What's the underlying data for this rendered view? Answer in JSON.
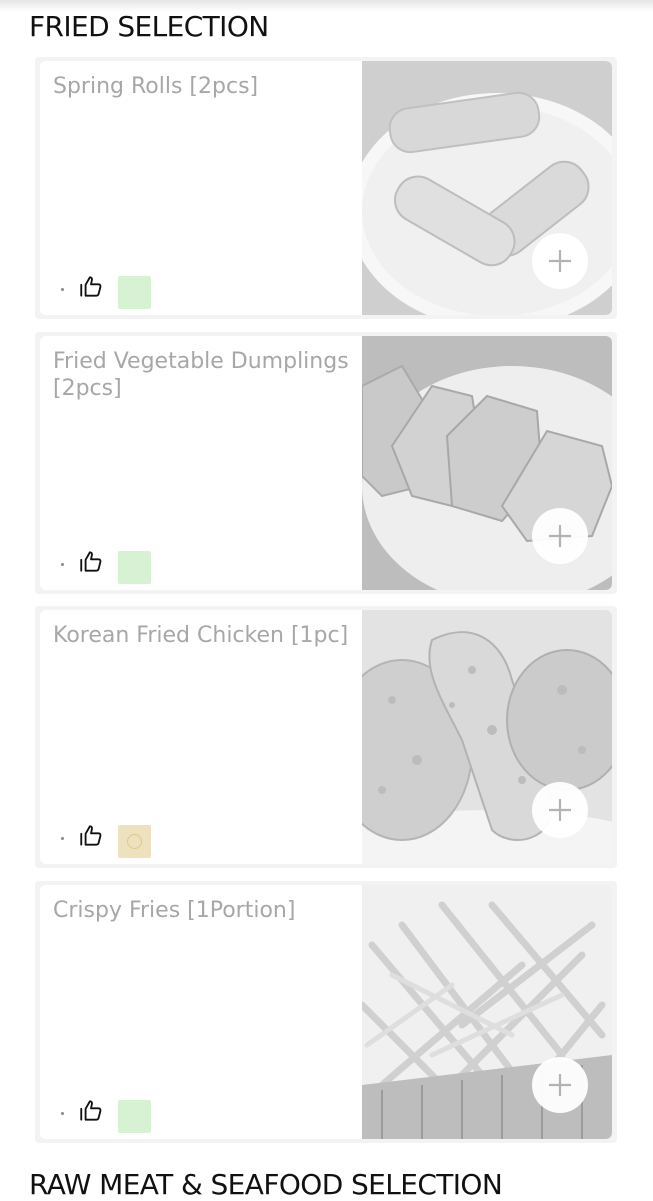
{
  "sections": [
    {
      "title": "FRIED SELECTION"
    },
    {
      "title": "RAW MEAT & SEAFOOD SELECTION"
    }
  ],
  "items": [
    {
      "name": "Spring Rolls [2pcs]",
      "badge": "veg",
      "icon": "thumbs-up-icon",
      "add_icon": "plus-icon"
    },
    {
      "name": "Fried Vegetable Dumplings [2pcs]",
      "badge": "veg",
      "icon": "thumbs-up-icon",
      "add_icon": "plus-icon"
    },
    {
      "name": "Korean Fried Chicken [1pc]",
      "badge": "egg",
      "icon": "thumbs-up-icon",
      "add_icon": "plus-icon"
    },
    {
      "name": "Crispy Fries [1Portion]",
      "badge": "veg",
      "icon": "thumbs-up-icon",
      "add_icon": "plus-icon"
    }
  ],
  "colors": {
    "veg_badge": "#d6f2d2",
    "egg_badge": "#eee1be",
    "item_name": "#a7a7a7",
    "section_title": "#111111"
  }
}
